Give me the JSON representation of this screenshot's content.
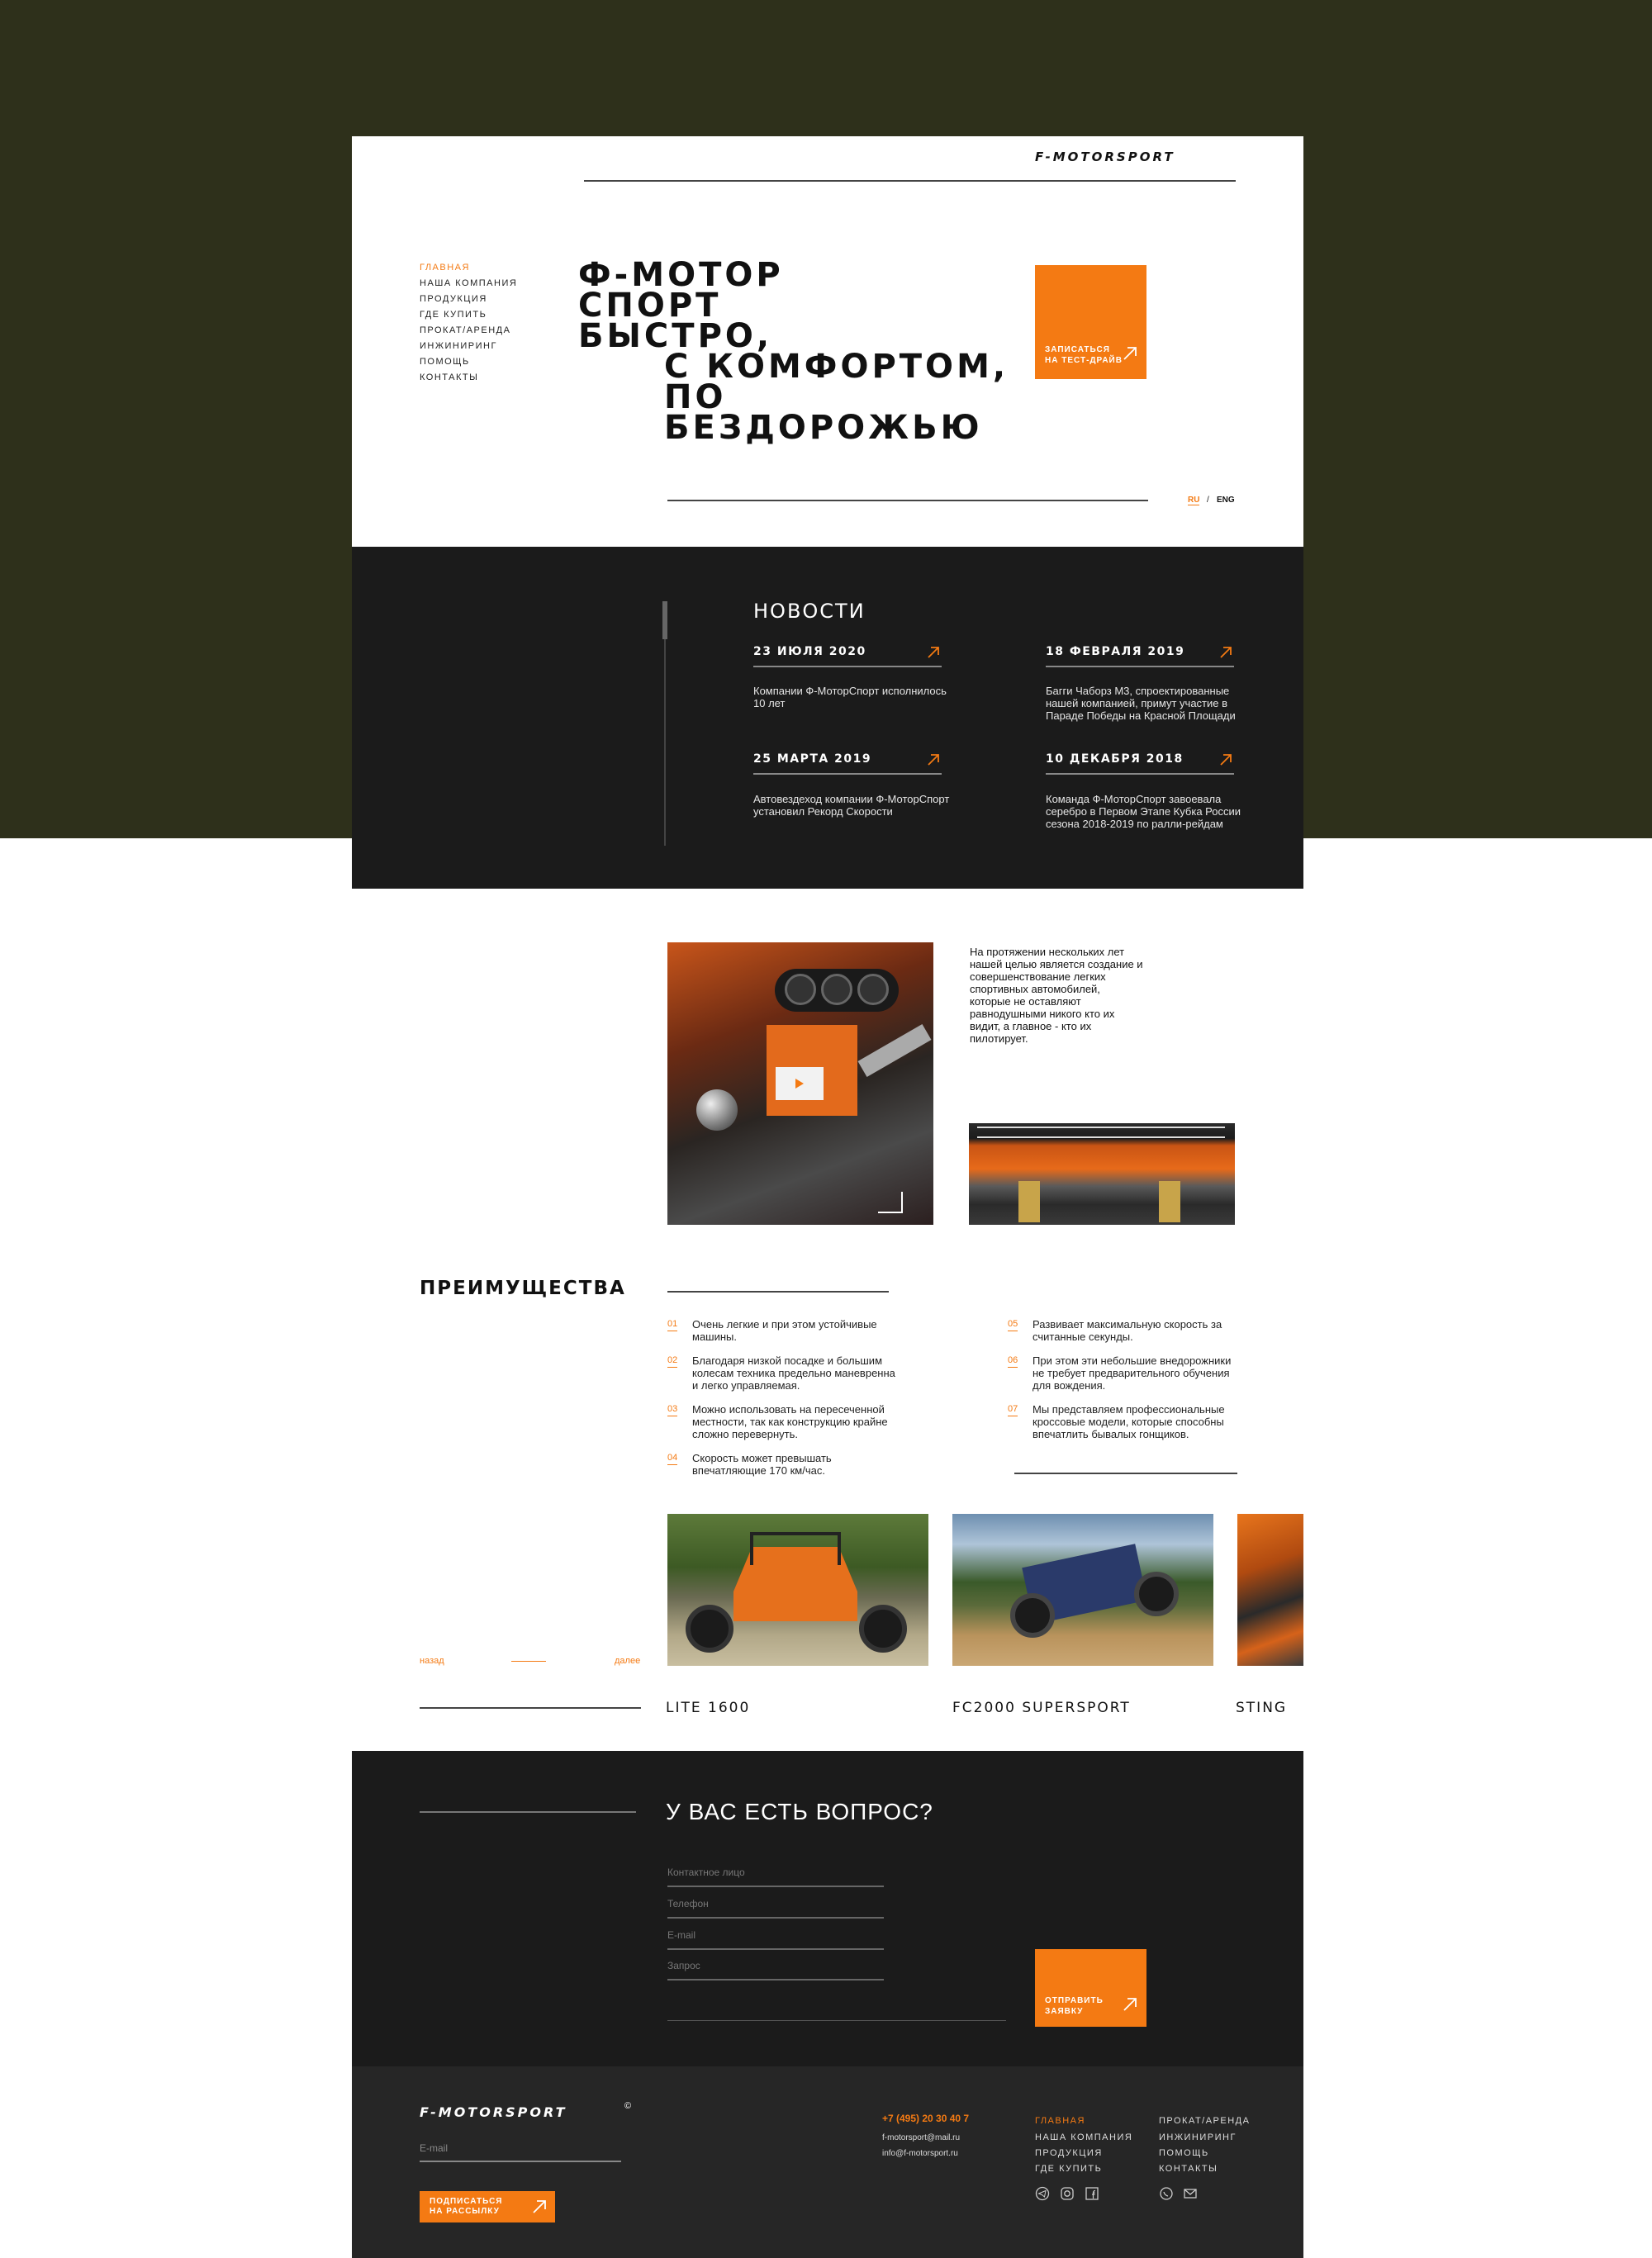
{
  "brand": {
    "logo": "F-MOTORSPORT"
  },
  "nav": {
    "items": [
      {
        "label": "ГЛАВНАЯ",
        "active": true
      },
      {
        "label": "НАША КОМПАНИЯ"
      },
      {
        "label": "ПРОДУКЦИЯ"
      },
      {
        "label": "ГДЕ КУПИТЬ"
      },
      {
        "label": "ПРОКАТ/АРЕНДА"
      },
      {
        "label": "ИНЖИНИРИНГ"
      },
      {
        "label": "ПОМОЩЬ"
      },
      {
        "label": "КОНТАКТЫ"
      }
    ]
  },
  "hero": {
    "title_lines": [
      "Ф-МОТОР",
      "СПОРТ",
      "БЫСТРО,",
      "С КОМФОРТОМ,",
      "ПО",
      "БЕЗДОРОЖЬЮ"
    ],
    "cta_line1": "ЗАПИСАТЬСЯ",
    "cta_line2": "НА ТЕСТ-ДРАЙВ"
  },
  "lang": {
    "ru": "RU",
    "sep": "/",
    "eng": "ENG"
  },
  "news": {
    "title": "НОВОСТИ",
    "items": [
      {
        "date": "23 ИЮЛЯ 2020",
        "text": "Компании Ф-МоторСпорт исполнилось 10 лет"
      },
      {
        "date": "18 ФЕВРАЛЯ 2019",
        "text": "Багги Чаборз М3, спроектированные нашей компанией, примут участие в Параде Победы на Красной Площади"
      },
      {
        "date": "25 МАРТА 2019",
        "text": "Автовездеход компании Ф-МоторСпорт установил Рекорд Скорости"
      },
      {
        "date": "10 ДЕКАБРЯ 2018",
        "text": "Команда Ф-МоторСпорт завоевала серебро в Первом Этапе Кубка России сезона 2018-2019 по ралли-рейдам"
      }
    ]
  },
  "about": {
    "text": "На протяжении нескольких лет нашей целью является создание и совершенствование легких спортивных автомобилей, которые не оставляют равнодушными никого кто их видит, а главное - кто их пилотирует."
  },
  "advantages": {
    "title": "ПРЕИМУЩЕСТВА",
    "items": [
      {
        "num": "01",
        "text": "Очень легкие и при этом устойчивые машины."
      },
      {
        "num": "02",
        "text": "Благодаря низкой посадке и большим колесам техника предельно маневренна и легко управляемая."
      },
      {
        "num": "03",
        "text": "Можно использовать на пересеченной местности, так как конструкцию крайне сложно перевернуть."
      },
      {
        "num": "04",
        "text": "Скорость может превышать впечатляющие 170 км/час."
      },
      {
        "num": "05",
        "text": "Развивает максимальную скорость за считанные секунды."
      },
      {
        "num": "06",
        "text": "При этом эти небольшие внедорожники не требует предварительного обучения для вождения."
      },
      {
        "num": "07",
        "text": "Мы представляем профессиональные кроссовые модели, которые способны впечатлить бывалых гонщиков."
      }
    ]
  },
  "products": {
    "prev": "назад",
    "next": "далее",
    "items": [
      {
        "name": "LITE 1600"
      },
      {
        "name": "FC2000 SUPERSPORT"
      },
      {
        "name": "STING"
      }
    ]
  },
  "contact": {
    "title": "У ВАС ЕСТЬ ВОПРОС?",
    "fields": [
      "Контактное лицо",
      "Телефон",
      "E-mail",
      "Запрос"
    ],
    "submit_line1": "ОТПРАВИТЬ",
    "submit_line2": "ЗАЯВКУ"
  },
  "footer": {
    "logo": "F-MOTORSPORT",
    "copyright": "©",
    "email_placeholder": "E-mail",
    "subscribe_line1": "ПОДПИСАТЬСЯ",
    "subscribe_line2": "НА РАССЫЛКУ",
    "phone": "+7 (495) 20 30 40 7",
    "email1": "f-motorsport@mail.ru",
    "email2": "info@f-motorsport.ru",
    "nav_col1": [
      {
        "label": "ГЛАВНАЯ",
        "active": true
      },
      {
        "label": "НАША КОМПАНИЯ"
      },
      {
        "label": "ПРОДУКЦИЯ"
      },
      {
        "label": "ГДЕ КУПИТЬ"
      }
    ],
    "nav_col2": [
      {
        "label": "ПРОКАТ/АРЕНДА"
      },
      {
        "label": "ИНЖИНИРИНГ"
      },
      {
        "label": "ПОМОЩЬ"
      },
      {
        "label": "КОНТАКТЫ"
      }
    ],
    "social_icons": [
      "telegram-icon",
      "instagram-icon",
      "facebook-icon",
      "whatsapp-icon",
      "mail-icon"
    ]
  },
  "colors": {
    "accent": "#f47a13",
    "olive": "#2e301b",
    "dark": "#1b1b1b",
    "footer": "#262626"
  }
}
